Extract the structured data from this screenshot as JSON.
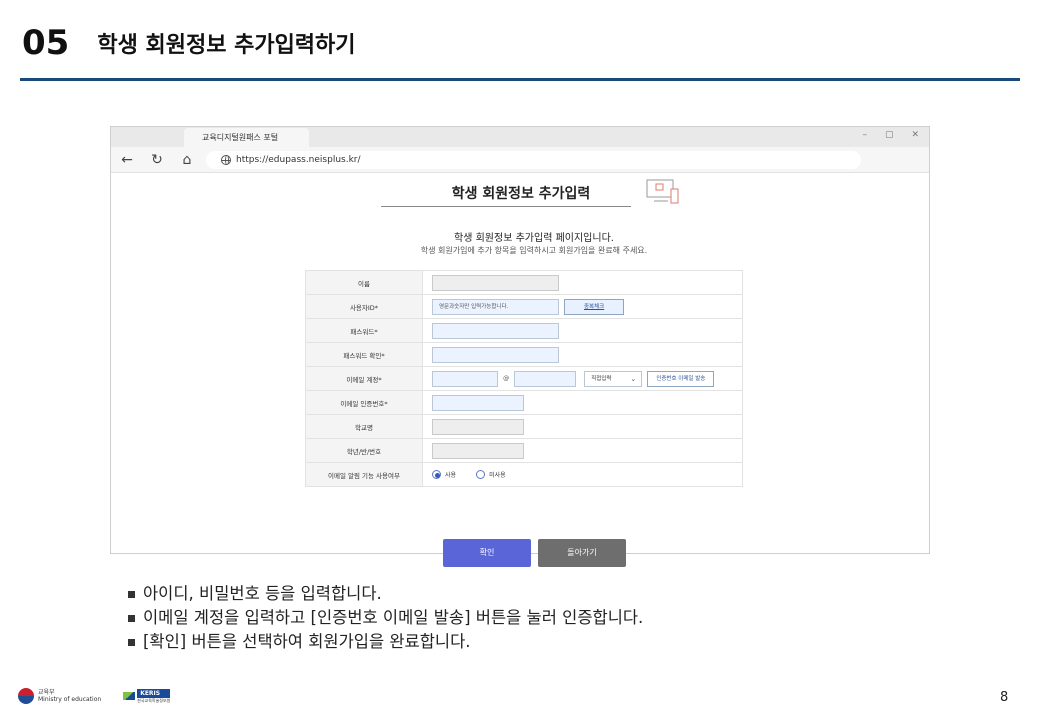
{
  "slide": {
    "number": "05",
    "title": "학생 회원정보 추가입력하기",
    "page_number": "8"
  },
  "browser": {
    "tab_title": "교육디지털원패스 포털",
    "url": "https://edupass.neisplus.kr/",
    "controls": [
      "–",
      "▢",
      "✕"
    ]
  },
  "form": {
    "title": "학생 회원정보 추가입력",
    "intro_main": "학생 회원정보 추가입력 페이지입니다.",
    "intro_sub": "학생 회원가입에 추가 항목을 입력하시고 회원가입을 완료해 주세요.",
    "rows": {
      "name": "이름",
      "user_id": "사용자ID*",
      "password": "패스워드*",
      "password_confirm": "패스워드 확인*",
      "email": "이메일 계정*",
      "email_code": "이메일 인증번호*",
      "school": "학교명",
      "grade_class": "학년/반/번호",
      "email_alert": "이메일 알림 기능 사용여부"
    },
    "user_id_placeholder": "영문과숫자만 입력가능합니다.",
    "dup_check_label": "중복체크",
    "email_at": "@",
    "email_domain_select": "직접입력",
    "send_code_label": "인증번호 이메일 발송",
    "alert_options": [
      "사용",
      "미사용"
    ],
    "alert_selected": "사용",
    "confirm_label": "확인",
    "back_label": "돌아가기"
  },
  "instructions": [
    "아이디, 비밀번호 등을 입력합니다.",
    "이메일 계정을 입력하고 [인증번호 이메일 발송] 버튼을 눌러 인증합니다.",
    "[확인] 버튼을 선택하여 회원가입을 완료합니다."
  ],
  "footer": {
    "moe_name": "교육부",
    "moe_sub": "Ministry of education",
    "keris_name": "KERIS",
    "keris_sub": "한국교육학술정보원"
  },
  "colors": {
    "header_rule": "#1a4a7a",
    "confirm_button": "#5a66d8",
    "back_button": "#6e6e6e",
    "input_blue": "#eaf3ff"
  }
}
